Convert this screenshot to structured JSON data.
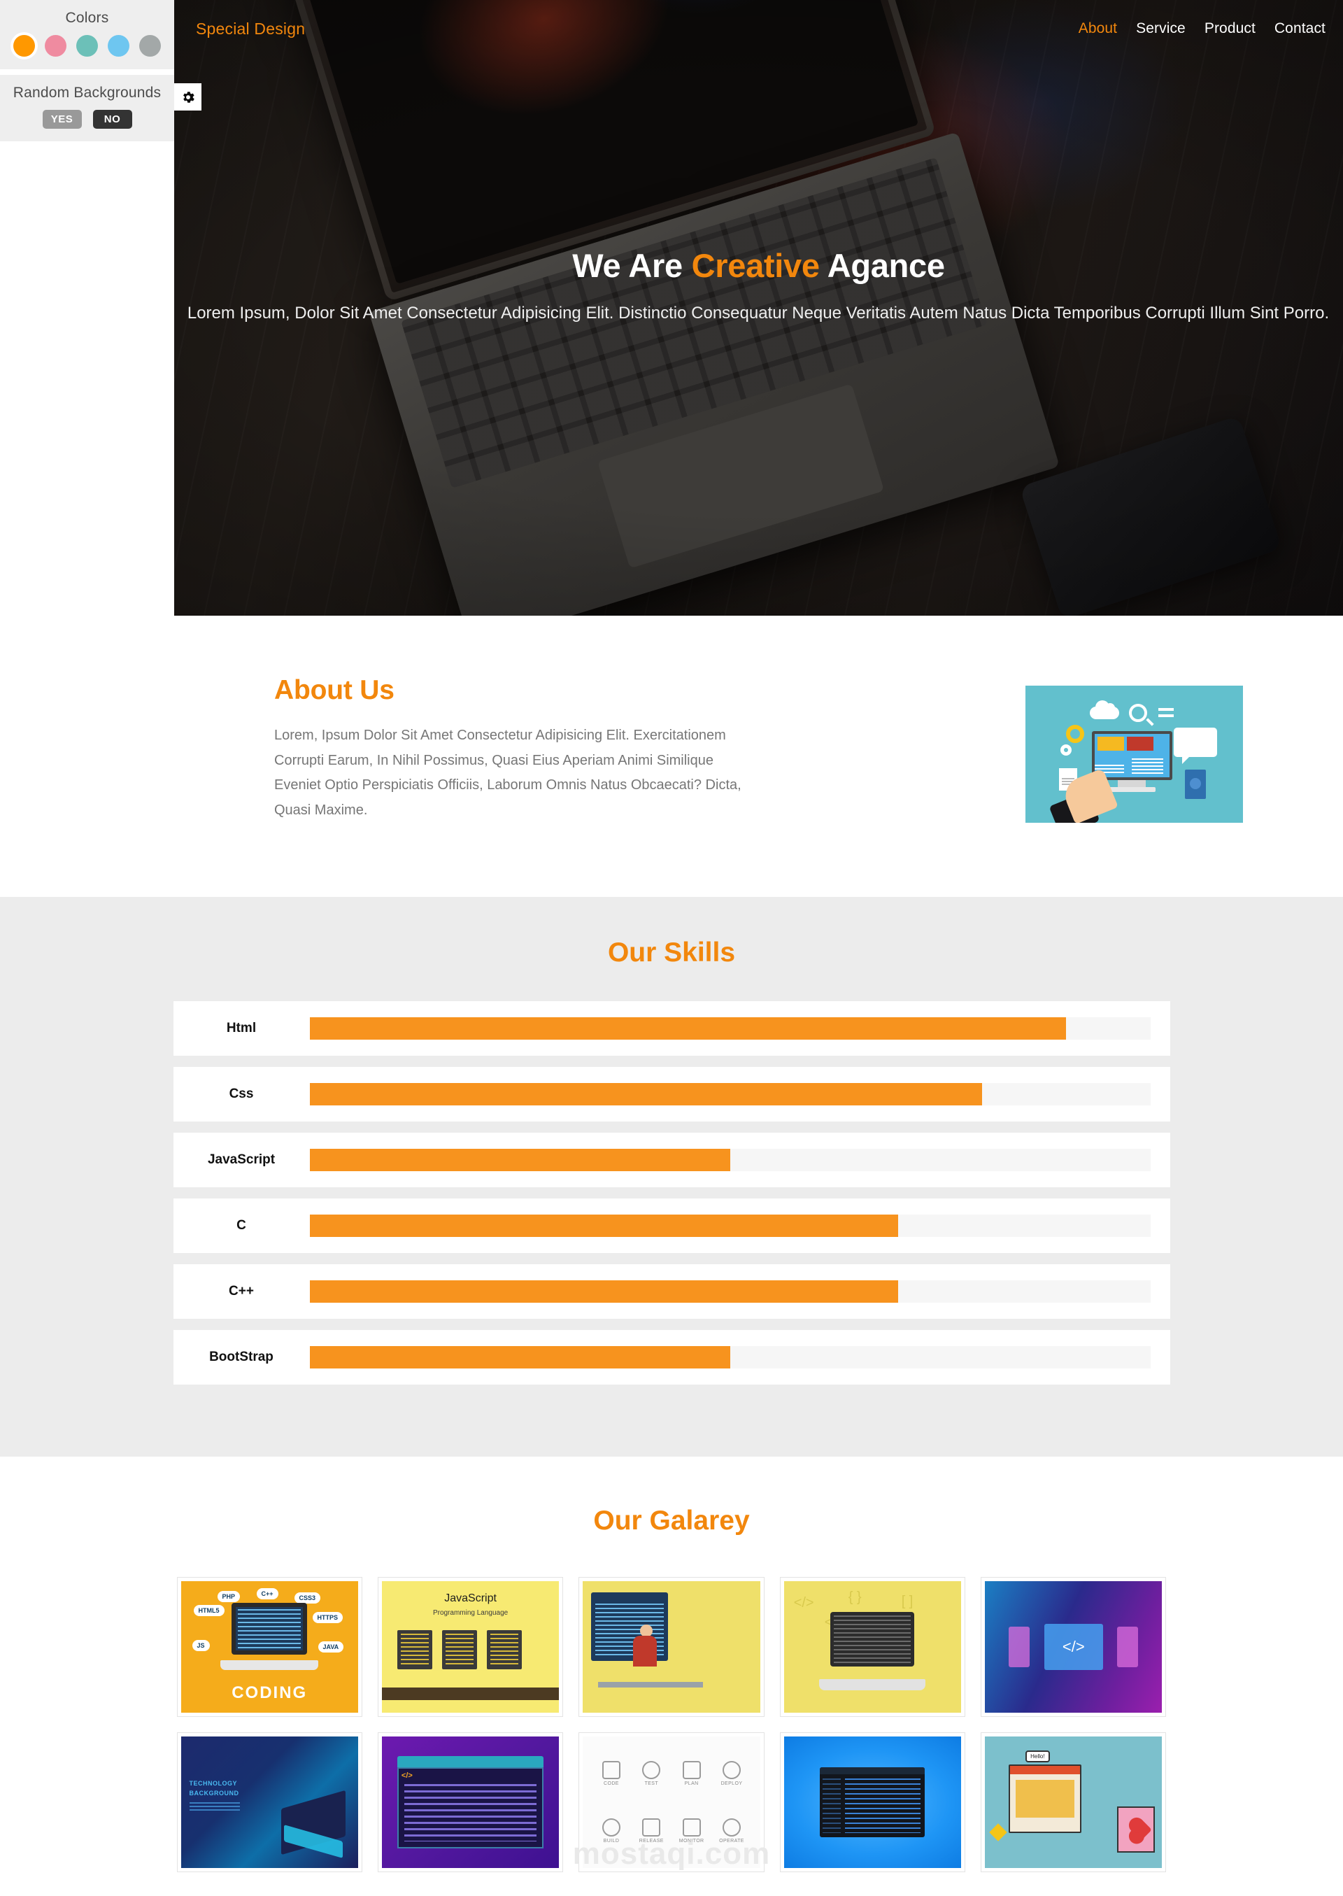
{
  "settings": {
    "colors_title": "Colors",
    "swatches": [
      {
        "name": "orange",
        "hex": "#ff9800",
        "active": true
      },
      {
        "name": "pink",
        "hex": "#ef8ba0",
        "active": false
      },
      {
        "name": "teal",
        "hex": "#6cc0b8",
        "active": false
      },
      {
        "name": "blue",
        "hex": "#6ec6f0",
        "active": false
      },
      {
        "name": "gray",
        "hex": "#a3a8a8",
        "active": false
      }
    ],
    "backgrounds_title": "Random Backgrounds",
    "yes_label": "YES",
    "no_label": "NO",
    "selected_background": "NO",
    "gear_icon": "gear-icon"
  },
  "nav": {
    "brand": "Special Design",
    "links": [
      {
        "label": "About",
        "active": true
      },
      {
        "label": "Service",
        "active": false
      },
      {
        "label": "Product",
        "active": false
      },
      {
        "label": "Contact",
        "active": false
      }
    ]
  },
  "hero": {
    "title_before": "We Are ",
    "title_accent": "Creative",
    "title_after": " Agance",
    "subtitle": "Lorem Ipsum, Dolor Sit Amet Consectetur Adipisicing Elit. Distinctio Consequatur Neque Veritatis Autem Natus Dicta Temporibus Corrupti Illum Sint Porro."
  },
  "about": {
    "title": "About Us",
    "text": "Lorem, Ipsum Dolor Sit Amet Consectetur Adipisicing Elit. Exercitationem Corrupti Earum, In Nihil Possimus, Quasi Eius Aperiam Animi Similique Eveniet Optio Perspiciatis Officiis, Laborum Omnis Natus Obcaecati? Dicta, Quasi Maxime.",
    "image_name": "about-illustration"
  },
  "skills": {
    "title": "Our Skills",
    "accent": "#f7931e",
    "items": [
      {
        "label": "Html",
        "percent": 90
      },
      {
        "label": "Css",
        "percent": 80
      },
      {
        "label": "JavaScript",
        "percent": 50
      },
      {
        "label": "C",
        "percent": 70
      },
      {
        "label": "C++",
        "percent": 70
      },
      {
        "label": "BootStrap",
        "percent": 50
      }
    ]
  },
  "gallery": {
    "title": "Our Galarey",
    "items": [
      {
        "name": "coding-bubbles",
        "caption": "CODING",
        "bubbles": [
          "PHP",
          "C++",
          "CSS3",
          "HTML5",
          "HTTPS",
          "JS",
          "JAVA"
        ]
      },
      {
        "name": "javascript-monitors",
        "title": "JavaScript",
        "subtitle": "Programming Language"
      },
      {
        "name": "developer-desk"
      },
      {
        "name": "laptop-code-symbols"
      },
      {
        "name": "devices-code-gradient"
      },
      {
        "name": "technology-background",
        "line1": "TECHNOLOGY",
        "line2": "BACKGROUND"
      },
      {
        "name": "code-window-purple",
        "tag": "</>"
      },
      {
        "name": "devops-icons",
        "labels": [
          "CODE",
          "TEST",
          "PLAN",
          "DEPLOY",
          "BUILD",
          "RELEASE",
          "MONITOR",
          "OPERATE"
        ]
      },
      {
        "name": "blue-code-editor"
      },
      {
        "name": "retro-ui-collage",
        "hello": "Hello!"
      }
    ]
  },
  "watermark": "mostaqi.com"
}
